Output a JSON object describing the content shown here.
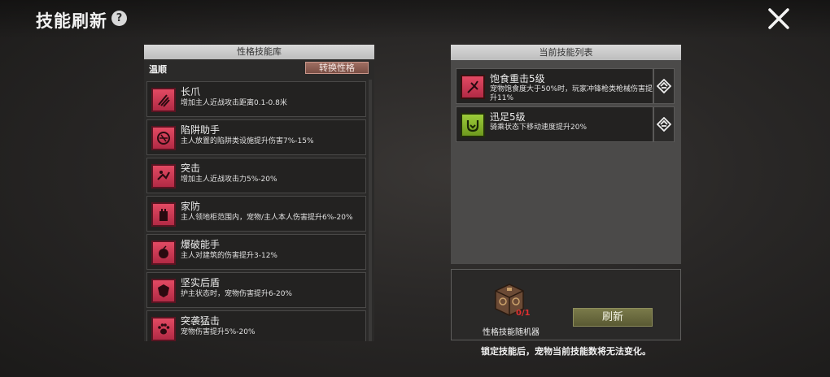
{
  "header": {
    "title": "技能刷新",
    "help_glyph": "?"
  },
  "left_panel": {
    "title": "性格技能库",
    "temperament": "温顺",
    "switch_label": "转换性格",
    "skills": [
      {
        "name": "长爪",
        "desc": "增加主人近战攻击距离0.1-0.8米",
        "icon": "claw-icon"
      },
      {
        "name": "陷阱助手",
        "desc": "主人放置的陷阱类设施提升伤害7%-15%",
        "icon": "trap-icon"
      },
      {
        "name": "突击",
        "desc": "增加主人近战攻击力5%-20%",
        "icon": "charge-icon"
      },
      {
        "name": "家防",
        "desc": "主人领地柜范围内，宠物/主人本人伤害提升6%-20%",
        "icon": "tower-icon"
      },
      {
        "name": "爆破能手",
        "desc": "主人对建筑的伤害提升3-12%",
        "icon": "bomb-icon"
      },
      {
        "name": "坚实后盾",
        "desc": "护主状态时，宠物伤害提升6-20%",
        "icon": "shield-icon"
      },
      {
        "name": "突袭猛击",
        "desc": "宠物伤害提升5%-20%",
        "icon": "paw-icon"
      }
    ]
  },
  "right_panel": {
    "title": "当前技能列表",
    "skills": [
      {
        "name": "饱食重击5级",
        "desc": "宠物饱食度大于50%时，玩家冲锋枪类枪械伤害提升11%",
        "icon": "fork-icon",
        "color": "#d63a55"
      },
      {
        "name": "迅足5级",
        "desc": "骑乘状态下移动速度提升20%",
        "icon": "speed-icon",
        "color": "#7fae2a"
      }
    ]
  },
  "bottom": {
    "randomizer_label": "性格技能随机器",
    "count": "0/1",
    "refresh_label": "刷新",
    "notice": "锁定技能后，宠物当前技能数将无法变化。"
  }
}
